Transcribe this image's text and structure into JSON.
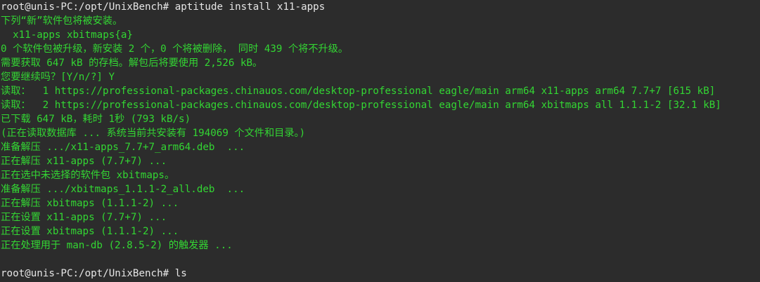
{
  "terminal": {
    "lines": [
      "root@unis-PC:/opt/UnixBench# aptitude install x11-apps",
      "下列“新”软件包将被安装。",
      "  x11-apps xbitmaps{a}",
      "0 个软件包被升级，新安装 2 个，0 个将被删除， 同时 439 个将不升级。",
      "需要获取 647 kB 的存档。解包后将要使用 2,526 kB。",
      "您要继续吗？[Y/n/?] Y",
      "读取：  1 https://professional-packages.chinauos.com/desktop-professional eagle/main arm64 x11-apps arm64 7.7+7 [615 kB]",
      "读取：  2 https://professional-packages.chinauos.com/desktop-professional eagle/main arm64 xbitmaps all 1.1.1-2 [32.1 kB]",
      "已下载 647 kB，耗时 1秒 (793 kB/s)",
      "(正在读取数据库 ... 系统当前共安装有 194069 个文件和目录。)",
      "准备解压 .../x11-apps_7.7+7_arm64.deb  ...",
      "正在解压 x11-apps (7.7+7) ...",
      "正在选中未选择的软件包 xbitmaps。",
      "准备解压 .../xbitmaps_1.1.1-2_all.deb  ...",
      "正在解压 xbitmaps (1.1.1-2) ...",
      "正在设置 x11-apps (7.7+7) ...",
      "正在设置 xbitmaps (1.1.1-2) ...",
      "正在处理用于 man-db (2.8.5-2) 的触发器 ...",
      "",
      "root@unis-PC:/opt/UnixBench# ls"
    ]
  },
  "colors": {
    "background": "#2c2c2c",
    "output_text": "#33d633",
    "prompt_text": "#e6e6e6"
  }
}
